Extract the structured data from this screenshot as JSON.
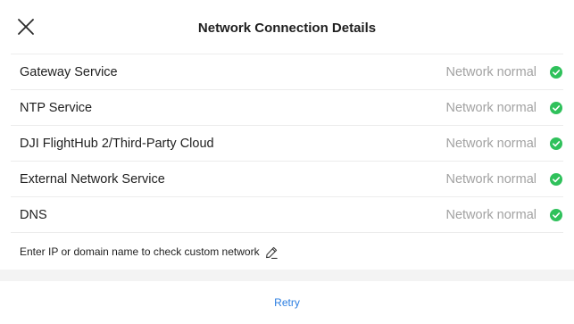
{
  "header": {
    "title": "Network Connection Details",
    "close_icon": "close-icon"
  },
  "colors": {
    "ok_green": "#2fc15b",
    "link_blue": "#2a7de1",
    "status_gray": "#a2a2a2"
  },
  "checks": [
    {
      "label": "Gateway Service",
      "status": "Network normal",
      "icon": "check-circle-icon"
    },
    {
      "label": "NTP Service",
      "status": "Network normal",
      "icon": "check-circle-icon"
    },
    {
      "label": "DJI FlightHub 2/Third-Party Cloud",
      "status": "Network normal",
      "icon": "check-circle-icon"
    },
    {
      "label": "External Network Service",
      "status": "Network normal",
      "icon": "check-circle-icon"
    },
    {
      "label": "DNS",
      "status": "Network normal",
      "icon": "check-circle-icon"
    }
  ],
  "custom": {
    "text": "Enter IP or domain name to check custom network",
    "icon": "edit-pencil-icon"
  },
  "footer": {
    "retry_label": "Retry"
  }
}
